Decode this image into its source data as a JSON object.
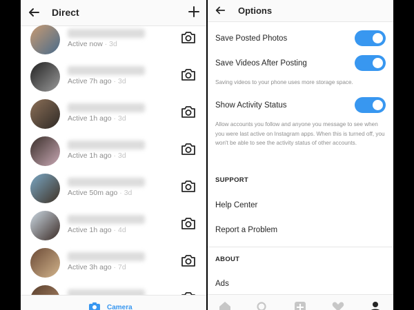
{
  "direct": {
    "title": "Direct",
    "back_icon": "arrow-left-icon",
    "new_icon": "plus-icon",
    "threads": [
      {
        "status": "Active now",
        "ago": "3d",
        "avatar_colors": [
          "#c79b73",
          "#4a6b8a"
        ]
      },
      {
        "status": "Active 7h ago",
        "ago": "3d",
        "avatar_colors": [
          "#222222",
          "#9a9a9a"
        ]
      },
      {
        "status": "Active 1h ago",
        "ago": "3d",
        "avatar_colors": [
          "#8b6f57",
          "#2f2a26"
        ]
      },
      {
        "status": "Active 1h ago",
        "ago": "3d",
        "avatar_colors": [
          "#3a2f2a",
          "#c8a8b4"
        ]
      },
      {
        "status": "Active 50m ago",
        "ago": "3d",
        "avatar_colors": [
          "#7aa7c4",
          "#3f3226"
        ]
      },
      {
        "status": "Active 1h ago",
        "ago": "4d",
        "avatar_colors": [
          "#cbd7e2",
          "#3b2d27"
        ]
      },
      {
        "status": "Active 3h ago",
        "ago": "7d",
        "avatar_colors": [
          "#6b4a36",
          "#d2b48c"
        ]
      },
      {
        "status": "",
        "ago": "",
        "avatar_colors": [
          "#5a3f2d",
          "#b08a6a"
        ]
      }
    ],
    "footer": {
      "label": "Camera",
      "icon": "camera-icon"
    }
  },
  "options": {
    "title": "Options",
    "back_icon": "arrow-left-icon",
    "toggles": {
      "save_photos": {
        "label": "Save Posted Photos",
        "on": true
      },
      "save_videos": {
        "label": "Save Videos After Posting",
        "on": true
      },
      "activity": {
        "label": "Show Activity Status",
        "on": true
      }
    },
    "video_hint": "Saving videos to your phone uses more storage space.",
    "activity_hint": "Allow accounts you follow and anyone you message to see when you were last active on Instagram apps. When this is turned off, you won't be able to see the activity status of other accounts.",
    "support": {
      "header": "SUPPORT",
      "help_center": "Help Center",
      "report": "Report a Problem"
    },
    "about": {
      "header": "ABOUT",
      "ads": "Ads"
    },
    "tabs": [
      "home-icon",
      "search-icon",
      "add-post-icon",
      "heart-icon",
      "profile-icon"
    ]
  },
  "colors": {
    "accent": "#3897f0",
    "muted": "#8e8e8e",
    "text": "#262626"
  }
}
